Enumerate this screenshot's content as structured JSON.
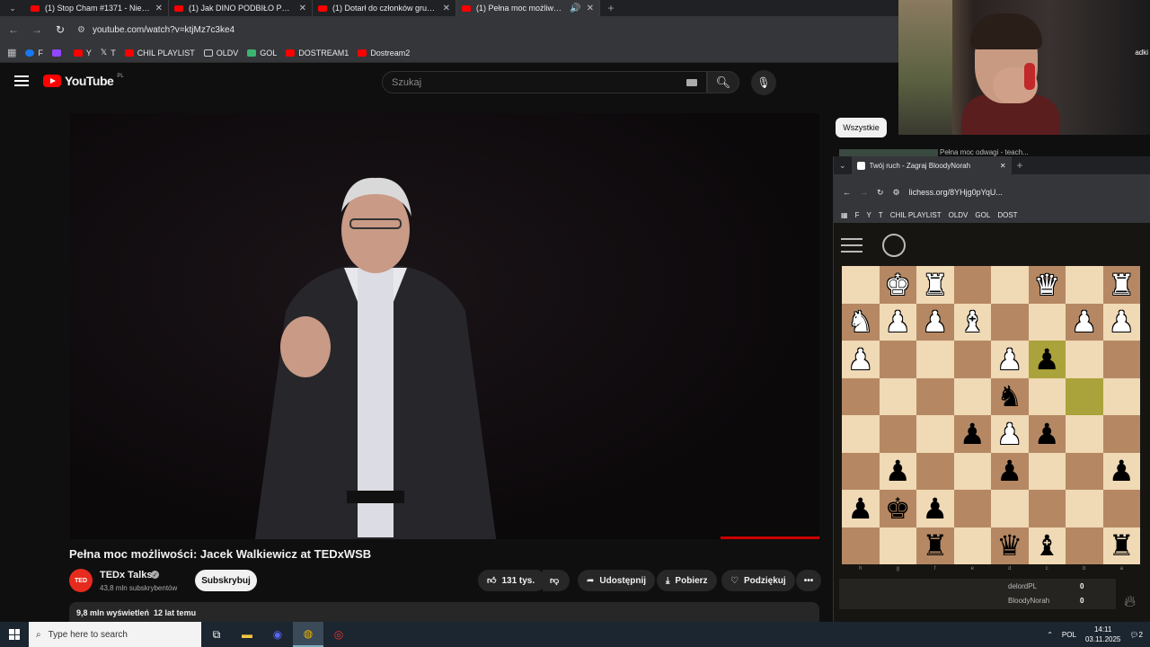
{
  "browser": {
    "tabs": [
      {
        "title": "(1) Stop Cham #1371 - Niebezpie",
        "active": false
      },
      {
        "title": "(1) Jak DINO PODBIŁO POLSKĘ",
        "active": false
      },
      {
        "title": "(1) Dotarł do członków grup pr",
        "active": false
      },
      {
        "title": "(1) Pełna moc możliwości: J",
        "active": true
      }
    ],
    "url": "youtube.com/watch?v=ktjMz7c3ke4",
    "bookmarks": [
      {
        "label": "F",
        "color": "#1877f2"
      },
      {
        "label": "",
        "color": "#9146ff"
      },
      {
        "label": "Y",
        "color": "#ff0000"
      },
      {
        "label": "T",
        "color": "#ffffff"
      },
      {
        "label": "CHIL PLAYLIST",
        "color": "#ff0000"
      },
      {
        "label": "OLDV",
        "color": "#cccccc"
      },
      {
        "label": "GOL",
        "color": "#3cb371"
      },
      {
        "label": "DOSTREAM1",
        "color": "#ff0000"
      },
      {
        "label": "Dostream2",
        "color": "#ff0000"
      }
    ]
  },
  "youtube": {
    "logo_text": "YouTube",
    "region": "PL",
    "search_placeholder": "Szukaj",
    "video_title": "Pełna moc możliwości: Jacek Walkiewicz at TEDxWSB",
    "channel": {
      "name": "TEDx Talks",
      "avatar": "TED",
      "subscribers": "43,8 mln subskrybentów"
    },
    "subscribe_label": "Subskrybuj",
    "likes": "131 tys.",
    "share_label": "Udostępnij",
    "download_label": "Pobierz",
    "thanks_label": "Podziękuj",
    "views": "9,8 mln wyświetleń",
    "age": "12 lat temu",
    "filter_chip": "Wszystkie",
    "related_snippet": "Pełna moc odwagi - teach..."
  },
  "webcam": {
    "label": "adki"
  },
  "lichess": {
    "tab_title": "Twój ruch - Zagraj BloodyNorah",
    "url": "lichess.org/8YHjg0pYqU...",
    "bookmarks": [
      "F",
      "",
      "Y",
      "T",
      "CHIL PLAYLIST",
      "OLDV",
      "GOL",
      "DOST"
    ],
    "files": [
      "h",
      "g",
      "f",
      "e",
      "d",
      "c",
      "b",
      "a"
    ],
    "ranks": [
      "1",
      "2",
      "3",
      "4",
      "5",
      "6",
      "7",
      "8"
    ],
    "board": [
      [
        "",
        "wK",
        "wR",
        "",
        "",
        "wQ",
        "",
        "wR"
      ],
      [
        "wN",
        "wP",
        "wP",
        "wB",
        "",
        "",
        "wP",
        "wP"
      ],
      [
        "wP",
        "",
        "",
        "",
        "wP",
        "bP",
        "",
        ""
      ],
      [
        "",
        "",
        "",
        "",
        "bN",
        "",
        "",
        ""
      ],
      [
        "",
        "",
        "",
        "bP",
        "wP",
        "bP",
        "",
        ""
      ],
      [
        "",
        "bP",
        "",
        "",
        "bP",
        "",
        "",
        "bP"
      ],
      [
        "bP",
        "bK",
        "bP",
        "",
        "",
        "",
        "",
        ""
      ],
      [
        "",
        "",
        "bR",
        "",
        "bQ",
        "bB",
        "",
        "bR"
      ]
    ],
    "highlights": [
      [
        2,
        5
      ],
      [
        3,
        6
      ]
    ],
    "players": [
      {
        "name": "delordPL",
        "score": "0"
      },
      {
        "name": "BloodyNorah",
        "score": "0"
      }
    ]
  },
  "taskbar": {
    "search_placeholder": "Type here to search",
    "language": "POL",
    "time": "14:11",
    "date": "03.11.2025",
    "notifications": "2"
  }
}
